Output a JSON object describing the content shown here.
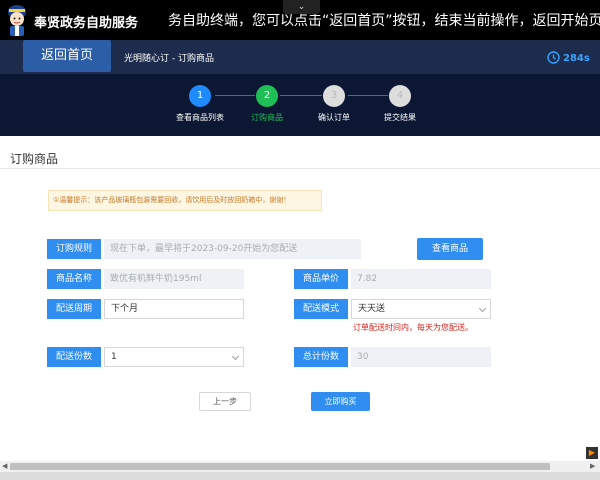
{
  "app_title": "奉贤政务自助服务",
  "marquee": "务自助终端，您可以点击“返回首页”按钮，结束当前操作，返回开始页面",
  "nav": {
    "home_label": "返回首页",
    "breadcrumb": "光明随心订 - 订购商品",
    "timer": "284s"
  },
  "steps": [
    {
      "num": "1",
      "label": "查看商品列表",
      "state": "done",
      "color": "#1e8bff"
    },
    {
      "num": "2",
      "label": "订购商品",
      "state": "active",
      "color": "#1fbf55"
    },
    {
      "num": "3",
      "label": "确认订单",
      "state": "todo",
      "color": "#dddddd"
    },
    {
      "num": "4",
      "label": "提交结果",
      "state": "todo",
      "color": "#dddddd"
    }
  ],
  "page_title": "订购商品",
  "tip": "①温馨提示：该产品玻璃瓶包装需要回收，请饮用后及时放回奶箱中，谢谢！",
  "form": {
    "rule_label": "订购规则",
    "rule_placeholder": "现在下单，最早将于2023-09-20开始为您配送",
    "view_goods_button": "查看商品",
    "name_label": "商品名称",
    "name_value": "致优有机鲜牛奶195ml",
    "price_label": "商品单价",
    "price_value": "7.82",
    "cycle_label": "配送周期",
    "cycle_value": "下个月",
    "mode_label": "配送模式",
    "mode_value": "天天送",
    "mode_note": "订单配送时间内，每天为您配送。",
    "qty_label": "配送份数",
    "qty_value": "1",
    "total_label": "总计份数",
    "total_value": "30"
  },
  "buttons": {
    "prev": "上一步",
    "buy": "立即购买"
  },
  "colors": {
    "header_bg": "#000000",
    "nav_bg": "#1d2c4c",
    "steps_bg": "#0c1833",
    "accent_blue": "#2f8ef0",
    "active_green": "#1fbf55",
    "warning_red": "#d2221a"
  }
}
